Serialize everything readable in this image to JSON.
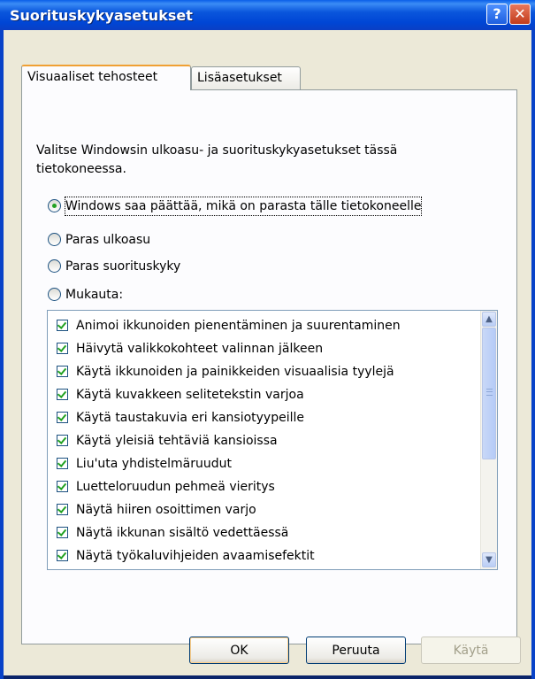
{
  "window": {
    "title": "Suorituskykyasetukset",
    "help_glyph": "?",
    "close_glyph": "✕"
  },
  "tabs": [
    {
      "label": "Visuaaliset tehosteet",
      "active": true
    },
    {
      "label": "Lisäasetukset",
      "active": false
    }
  ],
  "description": "Valitse Windowsin ulkoasu- ja suorituskykyasetukset tässä tietokoneessa.",
  "radios": [
    {
      "label": "Windows saa päättää, mikä on parasta tälle tietokoneelle",
      "selected": true
    },
    {
      "label": "Paras ulkoasu",
      "selected": false
    },
    {
      "label": "Paras suorituskyky",
      "selected": false
    },
    {
      "label": "Mukauta:",
      "selected": false
    }
  ],
  "effects": [
    "Animoi ikkunoiden pienentäminen ja suurentaminen",
    "Häivytä valikkokohteet valinnan jälkeen",
    "Käytä ikkunoiden ja painikkeiden visuaalisia tyylejä",
    "Käytä kuvakkeen selitetekstin varjoa",
    "Käytä taustakuvia eri kansiotyypeille",
    "Käytä yleisiä tehtäviä kansioissa",
    "Liu'uta yhdistelmäruudut",
    "Luetteloruudun pehmeä vieritys",
    "Näytä hiiren osoittimen varjo",
    "Näytä ikkunan sisältö vedettäessä",
    "Näytä työkaluvihjeiden avaamisefektit"
  ],
  "buttons": {
    "ok": "OK",
    "cancel": "Peruuta",
    "apply": "Käytä"
  },
  "scroll": {
    "up_glyph": "▲",
    "down_glyph": "▼"
  }
}
